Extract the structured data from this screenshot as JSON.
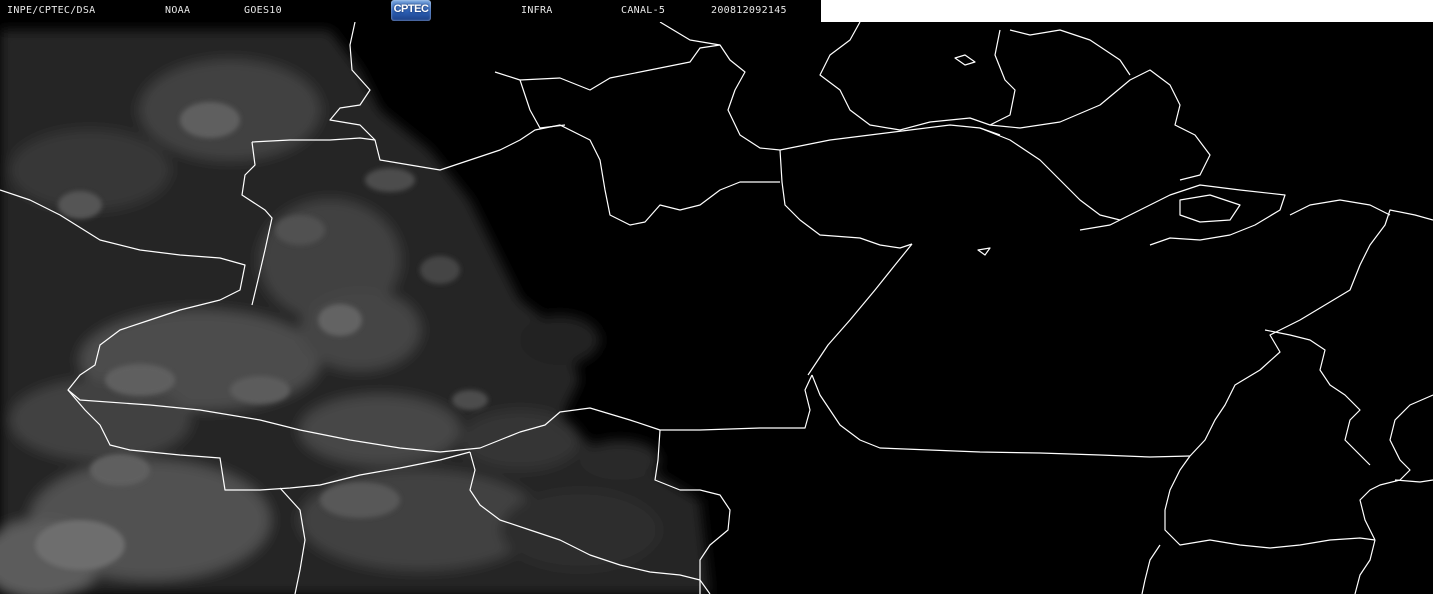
{
  "header": {
    "source": "INPE/CPTEC/DSA",
    "agency": "NOAA",
    "satellite": "GOES10",
    "logo_text": "CPTEC",
    "band_type": "INFRA",
    "channel": "CANAL-5",
    "timestamp": "200812092145"
  },
  "colors": {
    "background": "#000000",
    "border_lines": "#ffffff",
    "cloud": "#8a8a8a",
    "header_text": "#e8e8e8"
  },
  "map": {
    "type": "infrared satellite image",
    "features": [
      "cloud-cover",
      "political-borders"
    ]
  }
}
